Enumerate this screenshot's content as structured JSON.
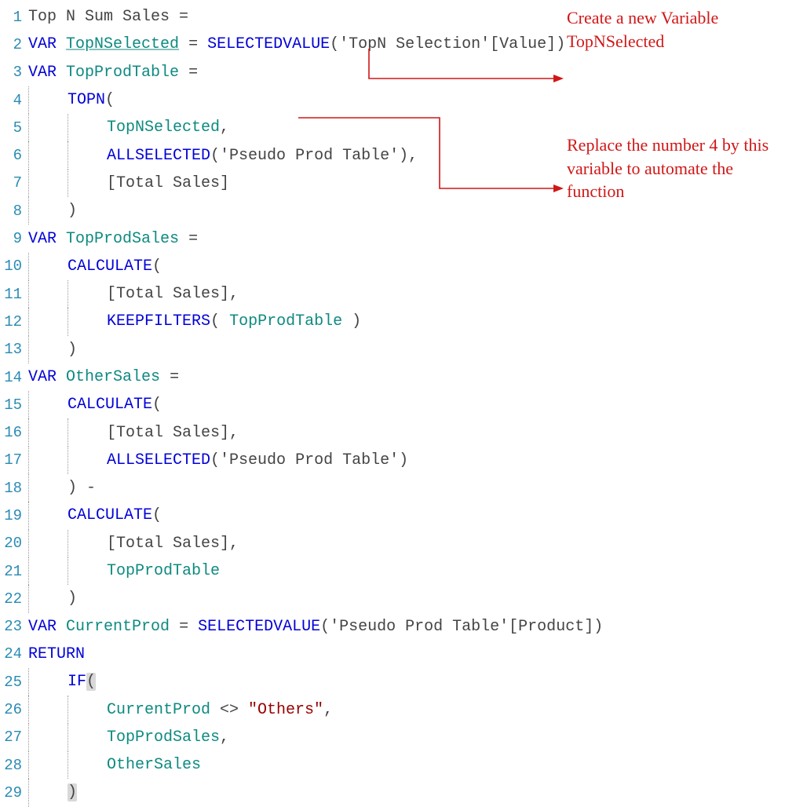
{
  "lines": {
    "l1": {
      "num": "1"
    },
    "l2": {
      "num": "2"
    },
    "l3": {
      "num": "3"
    },
    "l4": {
      "num": "4"
    },
    "l5": {
      "num": "5"
    },
    "l6": {
      "num": "6"
    },
    "l7": {
      "num": "7"
    },
    "l8": {
      "num": "8"
    },
    "l9": {
      "num": "9"
    },
    "l10": {
      "num": "10"
    },
    "l11": {
      "num": "11"
    },
    "l12": {
      "num": "12"
    },
    "l13": {
      "num": "13"
    },
    "l14": {
      "num": "14"
    },
    "l15": {
      "num": "15"
    },
    "l16": {
      "num": "16"
    },
    "l17": {
      "num": "17"
    },
    "l18": {
      "num": "18"
    },
    "l19": {
      "num": "19"
    },
    "l20": {
      "num": "20"
    },
    "l21": {
      "num": "21"
    },
    "l22": {
      "num": "22"
    },
    "l23": {
      "num": "23"
    },
    "l24": {
      "num": "24"
    },
    "l25": {
      "num": "25"
    },
    "l26": {
      "num": "26"
    },
    "l27": {
      "num": "27"
    },
    "l28": {
      "num": "28"
    },
    "l29": {
      "num": "29"
    }
  },
  "tokens": {
    "top_n_sum_sales": "Top N Sum Sales ",
    "eq": "= ",
    "eqsp": "=",
    "var": "VAR",
    "sp": " ",
    "topn_selected": "TopNSelected",
    "selectedvalue": "SELECTEDVALUE",
    "lp": "(",
    "rp": ")",
    "topn_sel_arg": "'TopN Selection'[Value]",
    "top_prod_table": "TopProdTable",
    "topn": "TOPN",
    "comma": ",",
    "allselected": "ALLSELECTED",
    "pseudo_prod_table_q": "'Pseudo Prod Table'",
    "total_sales": "[Total Sales]",
    "top_prod_sales": "TopProdSales",
    "calculate": "CALCULATE",
    "keepfilters": "KEEPFILTERS",
    "other_sales": "OtherSales",
    "minus": " -",
    "current_prod": "CurrentProd",
    "pseudo_prod_product": "'Pseudo Prod Table'[Product]",
    "return": "RETURN",
    "if": "IF",
    "neq": " <> ",
    "others_str": "\"Others\""
  },
  "annotations": {
    "a1": "Create a new Variable TopNSelected",
    "a2": "Replace the number 4 by this variable to automate the function"
  }
}
